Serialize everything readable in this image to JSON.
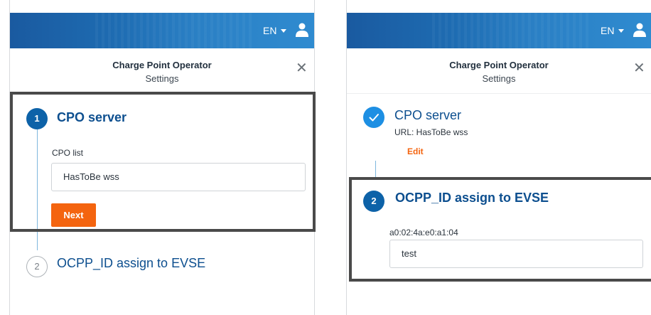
{
  "colors": {
    "brand_blue": "#0d62a8",
    "accent_orange": "#f4640f",
    "done_blue": "#1d8fe3",
    "highlight_gray": "#4a4a4a"
  },
  "left": {
    "topbar": {
      "language": "EN",
      "language_icon": "chevron-down-icon",
      "user_icon": "user-icon"
    },
    "header": {
      "title": "Charge Point Operator",
      "subtitle": "Settings",
      "close_icon": "close-icon"
    },
    "step1": {
      "number": "1",
      "title": "CPO server",
      "field_label": "CPO list",
      "selected_value": "HasToBe wss",
      "next_label": "Next"
    },
    "step2": {
      "number": "2",
      "title": "OCPP_ID assign to EVSE"
    }
  },
  "right": {
    "topbar": {
      "language": "EN",
      "language_icon": "chevron-down-icon",
      "user_icon": "user-icon"
    },
    "header": {
      "title": "Charge Point Operator",
      "subtitle": "Settings",
      "close_icon": "close-icon"
    },
    "step1": {
      "status_icon": "checkmark-icon",
      "title": "CPO server",
      "url": "URL: HasToBe wss",
      "edit_label": "Edit"
    },
    "step2": {
      "number": "2",
      "title": "OCPP_ID assign to EVSE",
      "field_label": "a0:02:4a:e0:a1:04",
      "input_value": "test"
    }
  }
}
